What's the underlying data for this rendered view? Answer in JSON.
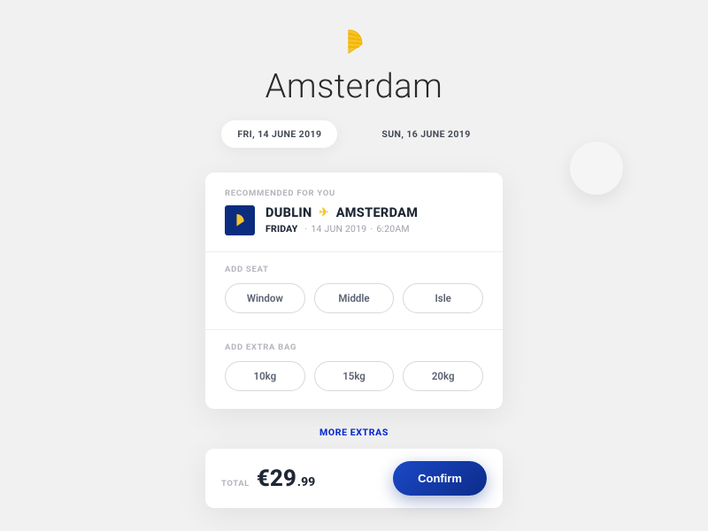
{
  "header": {
    "destination": "Amsterdam"
  },
  "dates": {
    "depart": "FRI, 14 JUNE 2019",
    "return": "SUN, 16 JUNE 2019"
  },
  "card": {
    "recommended_label": "RECOMMENDED FOR YOU",
    "origin": "DUBLIN",
    "destination": "AMSTERDAM",
    "day": "FRIDAY",
    "date": "14 JUN 2019",
    "time": "6:20AM",
    "seat": {
      "label": "ADD SEAT",
      "options": {
        "window": "Window",
        "middle": "Middle",
        "isle": "Isle"
      }
    },
    "bag": {
      "label": "ADD EXTRA BAG",
      "options": {
        "ten": "10kg",
        "fifteen": "15kg",
        "twenty": "20kg"
      }
    }
  },
  "more_extras": "MORE EXTRAS",
  "total": {
    "label": "TOTAL",
    "currency": "€",
    "major": "29",
    "minor": ".99"
  },
  "confirm": "Confirm"
}
